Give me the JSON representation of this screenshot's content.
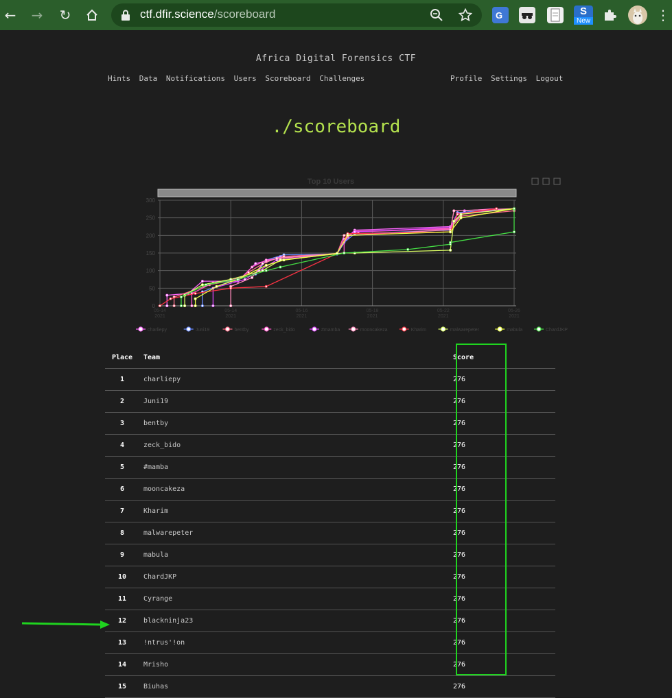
{
  "browser": {
    "url_host": "ctf.dfir.science",
    "url_path": "/scoreboard",
    "new_badge": "New"
  },
  "site": {
    "brand": "Africa Digital Forensics CTF",
    "nav_left": [
      "Hints",
      "Data",
      "Notifications",
      "Users",
      "Scoreboard",
      "Challenges"
    ],
    "nav_right": [
      "Profile",
      "Settings",
      "Logout"
    ],
    "page_title": "./scoreboard"
  },
  "chart_data": {
    "type": "line",
    "title": "Top 10 Users",
    "yticks": [
      0,
      50,
      100,
      150,
      200,
      250,
      300
    ],
    "ylim": [
      0,
      300
    ],
    "xticks": [
      "05-14\n2021",
      "05-14\n2021",
      "05-16\n2021",
      "05-18\n2021",
      "05-22\n2021",
      "05-26\n2021"
    ],
    "legend_position": "bottom",
    "grid": true,
    "series": [
      {
        "name": "charliepy",
        "color": "#ff66ff"
      },
      {
        "name": "Juni19",
        "color": "#6a8cff"
      },
      {
        "name": "bentby",
        "color": "#ff6e8a"
      },
      {
        "name": "zeck_bido",
        "color": "#ff55cc"
      },
      {
        "name": "#mamba",
        "color": "#dd44ff"
      },
      {
        "name": "mooncakeza",
        "color": "#ff88bb"
      },
      {
        "name": "Kharim",
        "color": "#ff3344"
      },
      {
        "name": "malwarepeter",
        "color": "#ddff66"
      },
      {
        "name": "mabula",
        "color": "#eeff44"
      },
      {
        "name": "ChardJKP",
        "color": "#44dd44"
      }
    ]
  },
  "table": {
    "headers": {
      "place": "Place",
      "team": "Team",
      "score": "Score"
    },
    "rows": [
      {
        "place": "1",
        "team": "charliepy",
        "score": "276"
      },
      {
        "place": "2",
        "team": "Juni19",
        "score": "276"
      },
      {
        "place": "3",
        "team": "bentby",
        "score": "276"
      },
      {
        "place": "4",
        "team": "zeck_bido",
        "score": "276"
      },
      {
        "place": "5",
        "team": "#mamba",
        "score": "276"
      },
      {
        "place": "6",
        "team": "mooncakeza",
        "score": "276"
      },
      {
        "place": "7",
        "team": "Kharim",
        "score": "276"
      },
      {
        "place": "8",
        "team": "malwarepeter",
        "score": "276"
      },
      {
        "place": "9",
        "team": "mabula",
        "score": "276"
      },
      {
        "place": "10",
        "team": "ChardJKP",
        "score": "276"
      },
      {
        "place": "11",
        "team": "Cyrange",
        "score": "276"
      },
      {
        "place": "12",
        "team": "blackninja23",
        "score": "276"
      },
      {
        "place": "13",
        "team": "!ntrus'!on",
        "score": "276"
      },
      {
        "place": "14",
        "team": "Mrisho",
        "score": "276"
      },
      {
        "place": "15",
        "team": "Biuhas",
        "score": "276"
      }
    ]
  }
}
